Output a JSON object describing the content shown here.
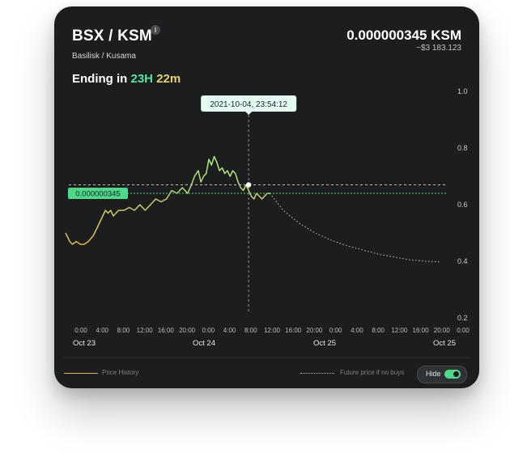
{
  "header": {
    "pair": "BSX / KSM",
    "info_icon": "i",
    "subtitle": "Basilisk / Kusama",
    "price": "0.000000345 KSM",
    "usd_value": "~$3 183.123",
    "ending_label": "Ending in",
    "ending_hours": "23H",
    "ending_minutes": "22m"
  },
  "legend": {
    "price_history": "Price History",
    "future_price": "Future price if no buys",
    "hide_button": "Hide"
  },
  "colors": {
    "background": "#1b1d1f",
    "price_line_low": "#e2b64e",
    "price_line_high": "#a6f07b",
    "current_price_line": "#4fd88a",
    "future_line": "#c8ccce",
    "tooltip_bg": "#e6fff3"
  },
  "chart_data": {
    "type": "line",
    "tooltip": "2021-10-04, 23:54:12",
    "current_price_label": "0.000000345",
    "y_ticks": [
      "1.0",
      "0.8",
      "0.6",
      "0.4",
      "0.2"
    ],
    "ylim": [
      0.2,
      1.0
    ],
    "x_hour_ticks": [
      "0:00",
      "4:00",
      "8:00",
      "12:00",
      "16:00",
      "20:00",
      "0:00",
      "4:00",
      "8:00",
      "12:00",
      "16:00",
      "20:00",
      "0:00",
      "4:00",
      "8:00",
      "12:00",
      "16:00",
      "20:00",
      "0:00"
    ],
    "x_date_ticks": [
      "Oct 23",
      "Oct 24",
      "Oct 25",
      "Oct 25"
    ],
    "x_range_hours": [
      0,
      72
    ],
    "current_price_level": 0.64,
    "hover_price_level": 0.67,
    "hover_hour": 34.5,
    "series": [
      {
        "name": "Price History",
        "x": [
          0,
          0.8,
          1.3,
          2,
          2.8,
          3.5,
          4.3,
          5.2,
          6,
          6.5,
          7,
          7.5,
          8,
          8.5,
          9,
          9.5,
          10,
          11,
          12,
          13,
          14,
          15,
          16,
          17,
          18,
          19,
          20,
          21,
          22,
          23,
          23.7,
          24.3,
          25,
          25.5,
          26,
          26.5,
          27,
          27.5,
          28,
          28.5,
          29,
          29.5,
          30,
          30.5,
          31,
          31.5,
          32,
          32.5,
          33,
          33.5,
          34,
          34.5,
          35,
          35.5,
          36,
          36.5,
          37,
          37.5,
          38,
          38.5
        ],
        "values": [
          0.5,
          0.47,
          0.46,
          0.47,
          0.46,
          0.46,
          0.47,
          0.49,
          0.52,
          0.54,
          0.56,
          0.58,
          0.57,
          0.58,
          0.56,
          0.57,
          0.58,
          0.58,
          0.59,
          0.58,
          0.6,
          0.58,
          0.6,
          0.62,
          0.61,
          0.62,
          0.65,
          0.64,
          0.66,
          0.64,
          0.67,
          0.7,
          0.72,
          0.68,
          0.7,
          0.71,
          0.76,
          0.74,
          0.77,
          0.75,
          0.72,
          0.73,
          0.71,
          0.72,
          0.7,
          0.72,
          0.71,
          0.68,
          0.66,
          0.65,
          0.67,
          0.65,
          0.63,
          0.62,
          0.64,
          0.63,
          0.62,
          0.63,
          0.64,
          0.64
        ]
      },
      {
        "name": "Future price if no buys",
        "x": [
          38.5,
          41,
          44,
          47,
          50,
          53,
          56,
          59,
          62,
          65,
          68,
          70.5
        ],
        "values": [
          0.64,
          0.58,
          0.535,
          0.5,
          0.475,
          0.455,
          0.44,
          0.425,
          0.415,
          0.405,
          0.4,
          0.398
        ]
      }
    ]
  }
}
